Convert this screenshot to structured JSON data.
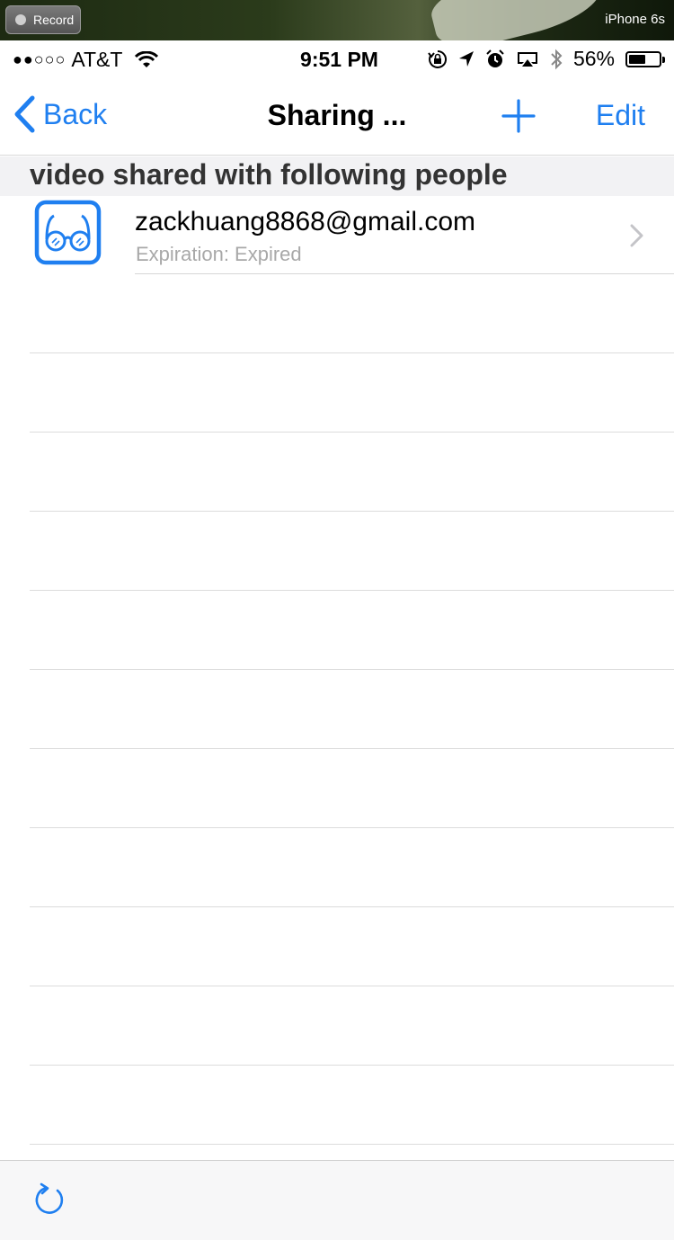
{
  "recording": {
    "button_label": "Record",
    "device": "iPhone 6s"
  },
  "status_bar": {
    "signal": "●●○○○",
    "carrier": "AT&T",
    "time": "9:51 PM",
    "battery": "56%",
    "battery_level": 0.56
  },
  "nav": {
    "back_label": "Back",
    "title": "Sharing ...",
    "edit_label": "Edit"
  },
  "section": {
    "header": "video shared with following people"
  },
  "shared_list": [
    {
      "email": "zackhuang8868@gmail.com",
      "expiration": "Expiration: Expired"
    }
  ],
  "colors": {
    "accent": "#1f7ff0",
    "separator": "#dcdcdc",
    "secondary_text": "#a8a8a8"
  },
  "icons": [
    "glasses-icon",
    "chevron-right-icon",
    "plus-icon",
    "back-chevron-icon",
    "refresh-icon",
    "wifi-icon",
    "location-icon",
    "alarm-icon",
    "airplay-icon",
    "bluetooth-icon",
    "orientation-lock-icon",
    "battery-icon"
  ]
}
